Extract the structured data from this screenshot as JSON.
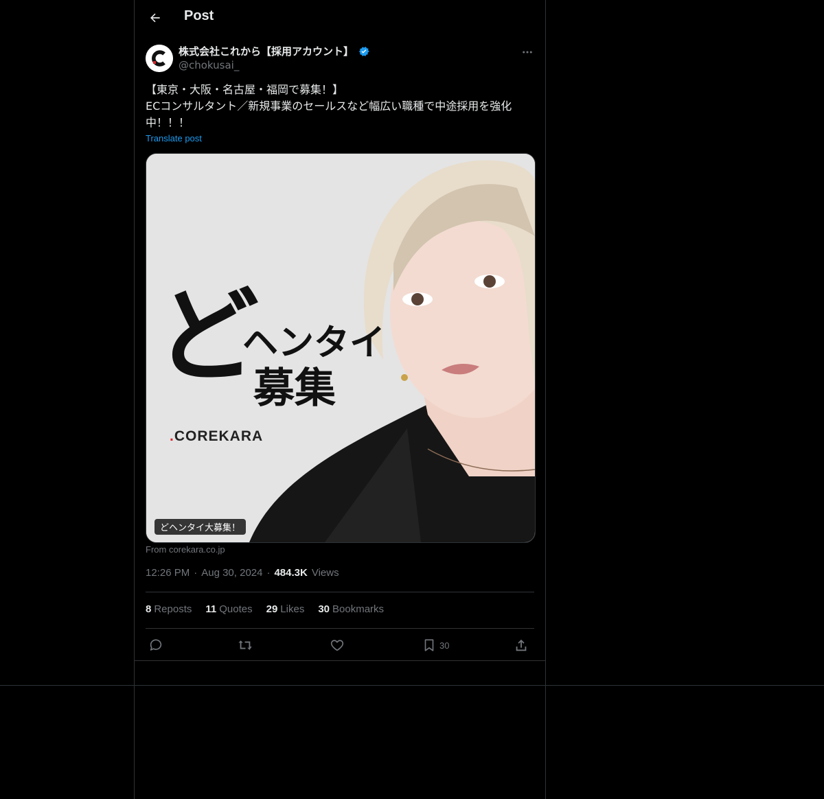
{
  "header": {
    "title": "Post"
  },
  "post": {
    "display_name": "株式会社これから【採用アカウント】",
    "handle": "@chokusai_",
    "verified": true,
    "text": "【東京・大阪・名古屋・福岡で募集！】\nECコンサルタント／新規事業のセールスなど幅広い職種で中途採用を強化中！！！",
    "translate_label": "Translate post",
    "avatar_letter": ".C",
    "media": {
      "headline_char": "ど",
      "headline_line1": "ヘンタイ",
      "headline_line2": "募集",
      "brand": "COREKARA",
      "brand_dot": ".",
      "alt_label": "どヘンタイ大募集！"
    },
    "source": "From corekara.co.jp",
    "time": "12:26 PM",
    "date": "Aug 30, 2024",
    "separator": "·",
    "views_count": "484.3K",
    "views_label": "Views"
  },
  "stats": [
    {
      "count": "8",
      "label": "Reposts"
    },
    {
      "count": "11",
      "label": "Quotes"
    },
    {
      "count": "29",
      "label": "Likes"
    },
    {
      "count": "30",
      "label": "Bookmarks"
    }
  ],
  "actions": {
    "bookmark_count": "30"
  },
  "colors": {
    "background": "#000000",
    "text": "#e7e9ea",
    "muted": "#71767b",
    "link": "#1d9bf0",
    "border": "#2f3336",
    "verified": "#1d9bf0",
    "brand_red": "#d6262c"
  },
  "icons": [
    "back-arrow-icon",
    "verified-badge-icon",
    "more-icon",
    "reply-icon",
    "repost-icon",
    "like-icon",
    "bookmark-icon",
    "share-icon"
  ]
}
